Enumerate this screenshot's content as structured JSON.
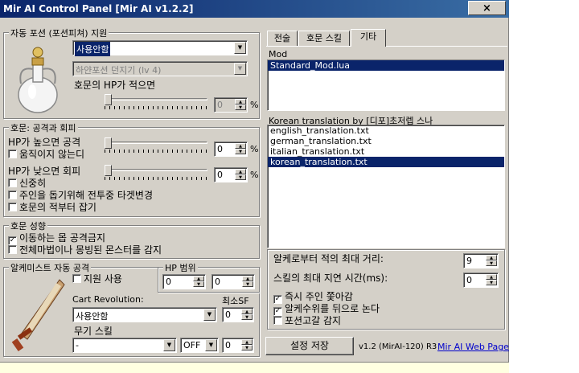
{
  "window": {
    "title": "Mir AI Control Panel [Mir AI v1.2.2]",
    "close_glyph": "×"
  },
  "potion": {
    "legend": "자동 포션 (포션피쳐) 지원",
    "mode_select": "사용안함",
    "type_select": "하얀포션 던지기 (lv 4)",
    "hp_label": "호문의 HP가 적으면",
    "hp_value": "0",
    "pct": "%"
  },
  "combat": {
    "legend": "호문: 공격과 회피",
    "hp_high_label": "HP가 높으면 공격",
    "hp_high_value": "0",
    "no_move_label": "움직이지 않는디",
    "hp_low_label": "HP가 낮으면 회피",
    "hp_low_value": "0",
    "careful_label": "신중히",
    "change_target_label": "주인을 돕기위해 전투중 타겟변경",
    "first_enemy_label": "호문의 적부터 잡기",
    "pct": "%"
  },
  "behavior": {
    "legend": "호문 성향",
    "no_attack_moving_label": "이동하는 몹 공격금지",
    "detect_mobbed_label": "전체마법이나 몽빙된 몬스터를 감지"
  },
  "alchemist": {
    "legend": "알케미스트 자동 공격",
    "support_label": "지원 사용",
    "range_label": "HP 범위",
    "range_min": "0",
    "range_max": "0",
    "cart_label": "Cart Revolution:",
    "min_sf_label": "최소SF",
    "cart_select": "사용안함",
    "cart_sf": "0",
    "weapon_label": "무기 스킬",
    "weapon_select": "-",
    "weapon_toggle": "OFF",
    "weapon_sf": "0"
  },
  "tabs": [
    {
      "label": "전술"
    },
    {
      "label": "호문 스킬"
    },
    {
      "label": "기타"
    }
  ],
  "mod": {
    "label": "Mod",
    "items": [
      "Standard_Mod.lua"
    ]
  },
  "translation": {
    "label": "Korean translation by [디포]초저렙 스나",
    "items": [
      "english_translation.txt",
      "german_translation.txt",
      "italian_translation.txt",
      "korean_translation.txt"
    ]
  },
  "misc": {
    "max_distance_label": "알케로부터 적의 최대 거리:",
    "max_distance_value": "9",
    "max_delay_label": "스킬의 최대 지연 시간(ms):",
    "max_delay_value": "0",
    "follow_owner_label": "즉시 주인 쫓아감",
    "follow_behind_label": "알케수위를 뒤으로 논다",
    "detect_potion_label": "포션고갈 감지"
  },
  "footer": {
    "save_button": "설정 저장",
    "version": "v1.2 (MirAI-120) R3",
    "web_link": "Mir AI Web Page"
  }
}
